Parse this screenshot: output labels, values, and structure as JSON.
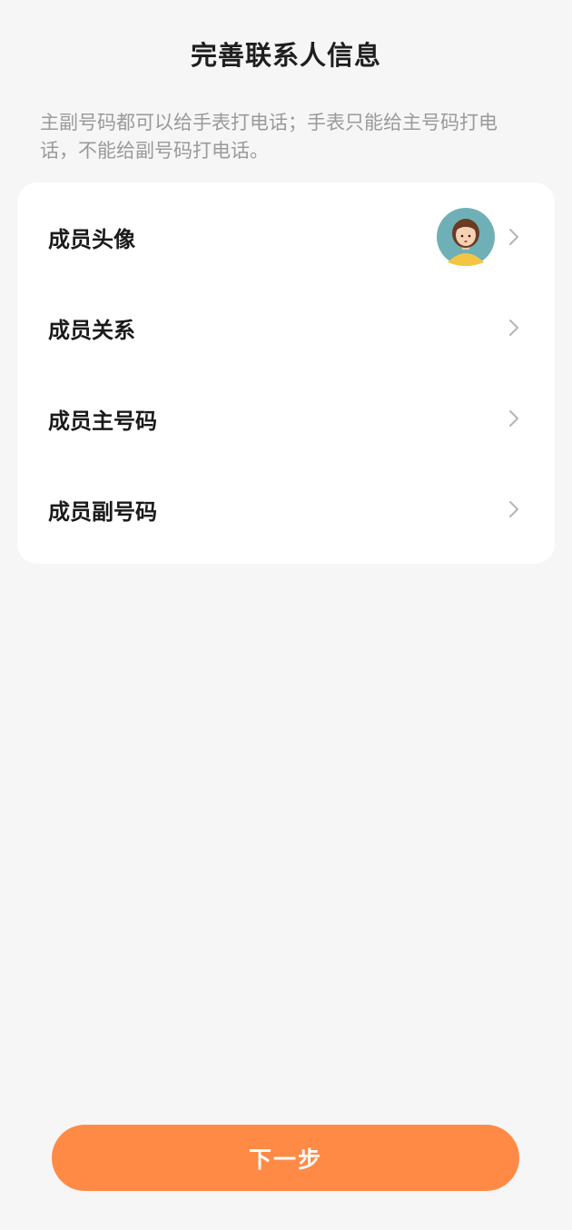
{
  "page": {
    "title": "完善联系人信息",
    "hint": "主副号码都可以给手表打电话；手表只能给主号码打电话，不能给副号码打电话。"
  },
  "rows": [
    {
      "label": "成员头像",
      "icon": "avatar"
    },
    {
      "label": "成员关系",
      "icon": "chevron-right-icon"
    },
    {
      "label": "成员主号码",
      "icon": "chevron-right-icon"
    },
    {
      "label": "成员副号码",
      "icon": "chevron-right-icon"
    }
  ],
  "footer": {
    "next_label": "下一步"
  },
  "colors": {
    "background": "#f6f6f6",
    "card": "#ffffff",
    "accent": "#ff8a45",
    "title": "#1f1f1f",
    "hint": "#9a9a9a",
    "chevron": "#b5b5b5"
  }
}
